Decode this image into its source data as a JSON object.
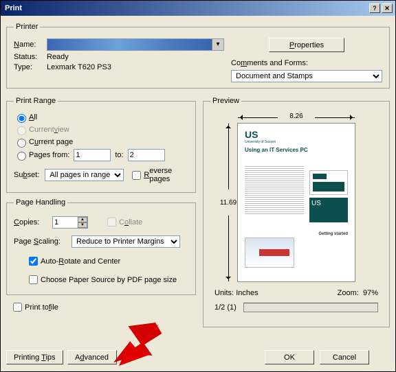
{
  "window": {
    "title": "Print"
  },
  "printer": {
    "legend": "Printer",
    "name_label": "Name:",
    "status_label": "Status:",
    "status_value": "Ready",
    "type_label": "Type:",
    "type_value": "Lexmark T620 PS3",
    "properties_btn": "Properties",
    "comments_label": "Comments and Forms:",
    "comments_value": "Document and Stamps"
  },
  "range": {
    "legend": "Print Range",
    "all": "All",
    "current_view": "Current view",
    "current_page": "Current page",
    "pages_from": "Pages from:",
    "from_val": "1",
    "to": "to:",
    "to_val": "2",
    "subset_label": "Subset:",
    "subset_value": "All pages in range",
    "reverse": "Reverse pages"
  },
  "handling": {
    "legend": "Page Handling",
    "copies_label": "Copies:",
    "copies_value": "1",
    "collate": "Collate",
    "scaling_label": "Page Scaling:",
    "scaling_value": "Reduce to Printer Margins",
    "autorotate": "Auto-Rotate and Center",
    "choose_source": "Choose Paper Source by PDF page size"
  },
  "print_to_file": "Print to file",
  "preview": {
    "legend": "Preview",
    "width": "8.26",
    "height": "11.69",
    "units_label": "Units:",
    "units_value": "Inches",
    "zoom_label": "Zoom:",
    "zoom_value": "97%",
    "page_indicator": "1/2 (1)",
    "doc": {
      "logo": "US",
      "sub": "University of Sussex",
      "title": "Using an IT Services PC",
      "started": "Getting started"
    }
  },
  "buttons": {
    "tips": "Printing Tips",
    "advanced": "Advanced",
    "ok": "OK",
    "cancel": "Cancel"
  }
}
